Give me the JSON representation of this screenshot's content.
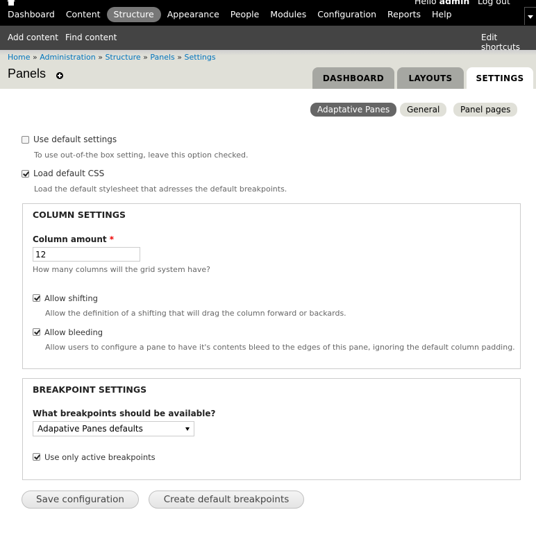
{
  "toolbar": {
    "menu": [
      "Dashboard",
      "Content",
      "Structure",
      "Appearance",
      "People",
      "Modules",
      "Configuration",
      "Reports",
      "Help"
    ],
    "hello_prefix": "Hello ",
    "username": "admin",
    "logout": "Log out"
  },
  "shortcuts": {
    "add_content": "Add content",
    "find_content": "Find content",
    "edit_shortcuts": "Edit shortcuts"
  },
  "breadcrumb": [
    "Home",
    "Administration",
    "Structure",
    "Panels",
    "Settings"
  ],
  "breadcrumb_separator": "»",
  "page_title": "Panels",
  "tabs": [
    "DASHBOARD",
    "LAYOUTS",
    "SETTINGS"
  ],
  "subtabs": [
    "Adaptative Panes",
    "General",
    "Panel pages"
  ],
  "form": {
    "use_default": {
      "label": "Use default settings",
      "desc": "To use out-of-the box setting, leave this option checked.",
      "checked": false
    },
    "load_css": {
      "label": "Load default CSS",
      "desc": "Load the default stylesheet that adresses the default breakpoints.",
      "checked": true
    },
    "column_settings": {
      "legend": "COLUMN SETTINGS",
      "column_amount_label": "Column amount",
      "required_mark": "*",
      "column_amount_value": "12",
      "column_amount_desc": "How many columns will the grid system have?",
      "allow_shifting": {
        "label": "Allow shifting",
        "desc": "Allow the definition of a shifting that will drag the column forward or backards.",
        "checked": true
      },
      "allow_bleeding": {
        "label": "Allow bleeding",
        "desc": "Allow users to configure a pane to have it's contents bleed to the edges of this pane, ignoring the default column padding.",
        "checked": true
      }
    },
    "breakpoint_settings": {
      "legend": "BREAKPOINT SETTINGS",
      "breakpoints_label": "What breakpoints should be available?",
      "breakpoints_value": "Adapative Panes defaults",
      "active_only": {
        "label": "Use only active breakpoints",
        "checked": true
      }
    },
    "save_button": "Save configuration",
    "create_button": "Create default breakpoints"
  }
}
